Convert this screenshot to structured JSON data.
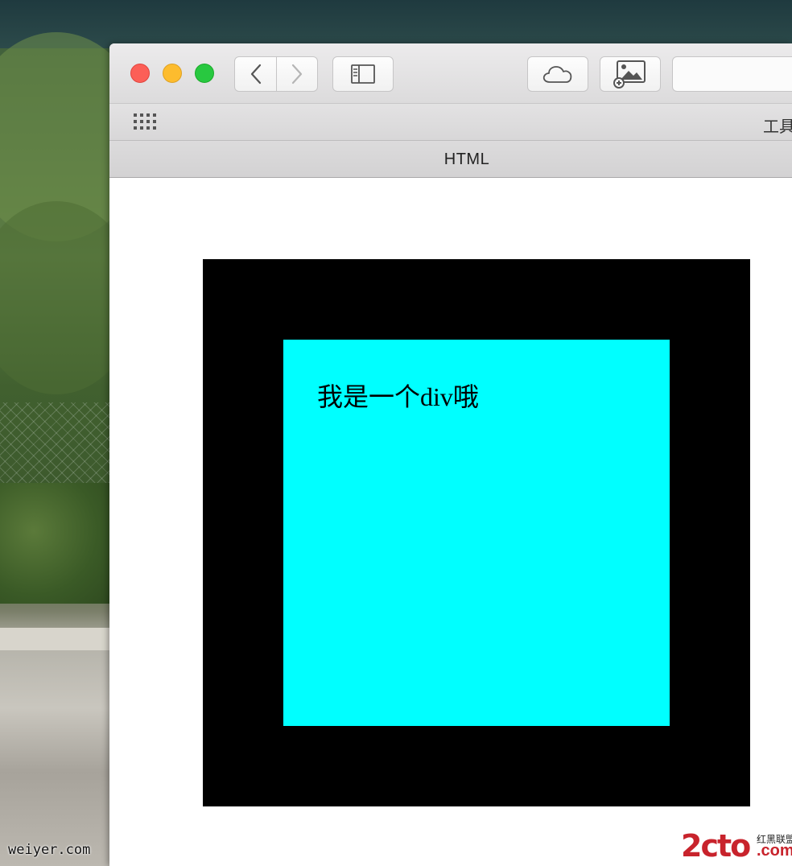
{
  "desktop": {
    "watermark": "weiyer.com"
  },
  "window": {
    "toolbar": {
      "back_icon": "chevron-left-icon",
      "forward_icon": "chevron-right-icon",
      "sidebar_icon": "sidebar-icon",
      "cloud_icon": "cloud-icon",
      "image_icon": "add-image-icon"
    },
    "favorites_bar": {
      "grid_icon": "grid-icon",
      "label": "工具"
    },
    "tab": {
      "title": "HTML"
    }
  },
  "page": {
    "inner_div_text": "我是一个div哦",
    "colors": {
      "outer_div": "#000000",
      "inner_div": "#00ffff"
    }
  },
  "logo": {
    "text": "2cto",
    "tagline": "红黑联盟",
    "suffix": ".com"
  }
}
